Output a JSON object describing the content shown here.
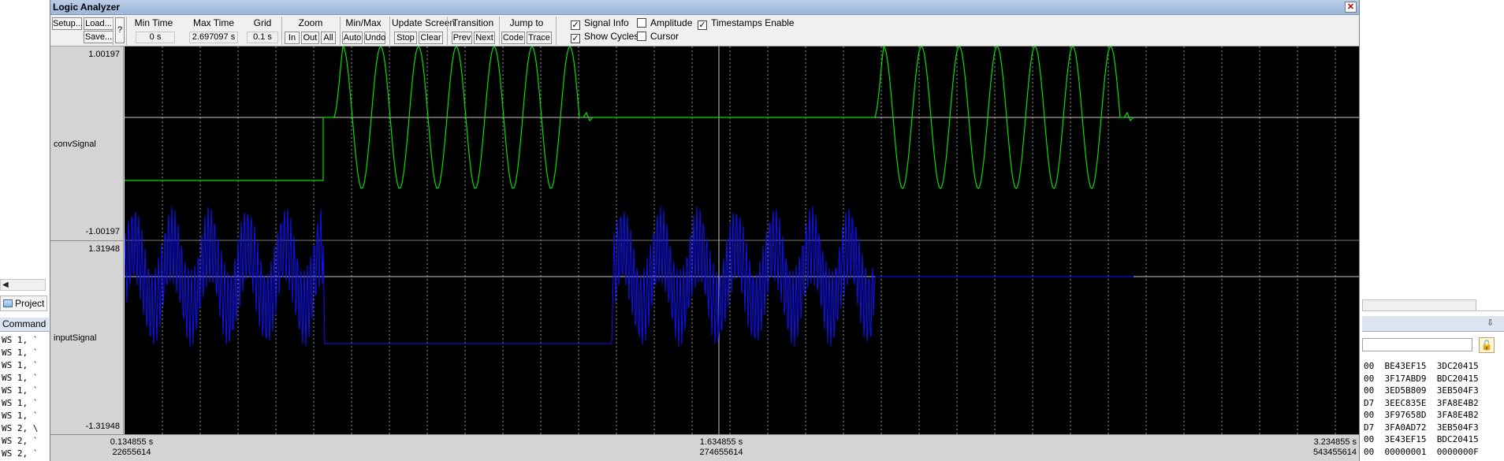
{
  "window": {
    "title": "Logic Analyzer",
    "close_icon": "✕"
  },
  "toolbar": {
    "setup_label": "Setup...",
    "load_label": "Load...",
    "save_label": "Save...",
    "help_label": "?",
    "min_time_label": "Min Time",
    "min_time_value": "0 s",
    "max_time_label": "Max Time",
    "max_time_value": "2.697097 s",
    "grid_label": "Grid",
    "grid_value": "0.1 s",
    "zoom_label": "Zoom",
    "zoom_in": "In",
    "zoom_out": "Out",
    "zoom_all": "All",
    "minmax_label": "Min/Max",
    "auto_label": "Auto",
    "undo_label": "Undo",
    "update_label": "Update Screen",
    "stop_label": "Stop",
    "clear_label": "Clear",
    "transition_label": "Transition",
    "prev_label": "Prev",
    "next_label": "Next",
    "jump_label": "Jump to",
    "code_label": "Code",
    "trace_label": "Trace",
    "signal_info": {
      "label": "Signal Info",
      "checked": true
    },
    "show_cycles": {
      "label": "Show Cycles",
      "checked": true
    },
    "amplitude": {
      "label": "Amplitude",
      "checked": false
    },
    "cursor": {
      "label": "Cursor",
      "checked": false
    },
    "timestamps": {
      "label": "Timestamps Enable",
      "checked": true
    }
  },
  "signals": [
    {
      "name": "convSignal",
      "max": "1.00197",
      "min": "-1.00197",
      "color": "#00e000"
    },
    {
      "name": "inputSignal",
      "max": "1.31948",
      "min": "-1.31948",
      "color": "#1010ff"
    }
  ],
  "time_axis": {
    "left_time": "0.134855 s",
    "left_cycles": "22655614",
    "mid_time": "1.634855 s",
    "mid_cycles": "274655614",
    "right_time": "3.234855 s",
    "right_cycles": "543455614"
  },
  "left_panel": {
    "project_label": "Project",
    "command_label": "Command",
    "scroll_arrow": "◀",
    "lines": [
      "WS 1, `",
      "WS 1, `",
      "WS 1, `",
      "WS 1, `",
      "WS 1, `",
      "WS 1, `",
      "WS 1, `",
      "WS 2, \\",
      "WS 2, `",
      "WS 2, `"
    ]
  },
  "right_panel": {
    "pin_icon": "⇩",
    "lock_icon": "🔓",
    "lines": [
      "00  BE43EF15  3DC20415",
      "00  3F17ABD9  BDC20415",
      "00  3ED5B809  3EB504F3",
      "D7  3EEC835E  3FA8E4B2",
      "00  3F97658D  3FA8E4B2",
      "D7  3FA0AD72  3EB504F3",
      "00  3E43EF15  BDC20415",
      "00  00000001  0000000F"
    ]
  },
  "colors": {
    "plot_bg": "#000000",
    "conv_trace": "#00e000",
    "input_trace": "#1010ff",
    "cursor_line": "#c8c8c8"
  },
  "chart_data": {
    "type": "line",
    "xlabel": "",
    "ylabel": "",
    "x_range": [
      0.134855,
      3.234855
    ],
    "series": [
      {
        "name": "convSignal",
        "amplitude": 1.0,
        "baseline": 0,
        "grid": true
      },
      {
        "name": "inputSignal",
        "amplitude": 1.31948,
        "baseline": 0,
        "grid": true
      }
    ]
  }
}
